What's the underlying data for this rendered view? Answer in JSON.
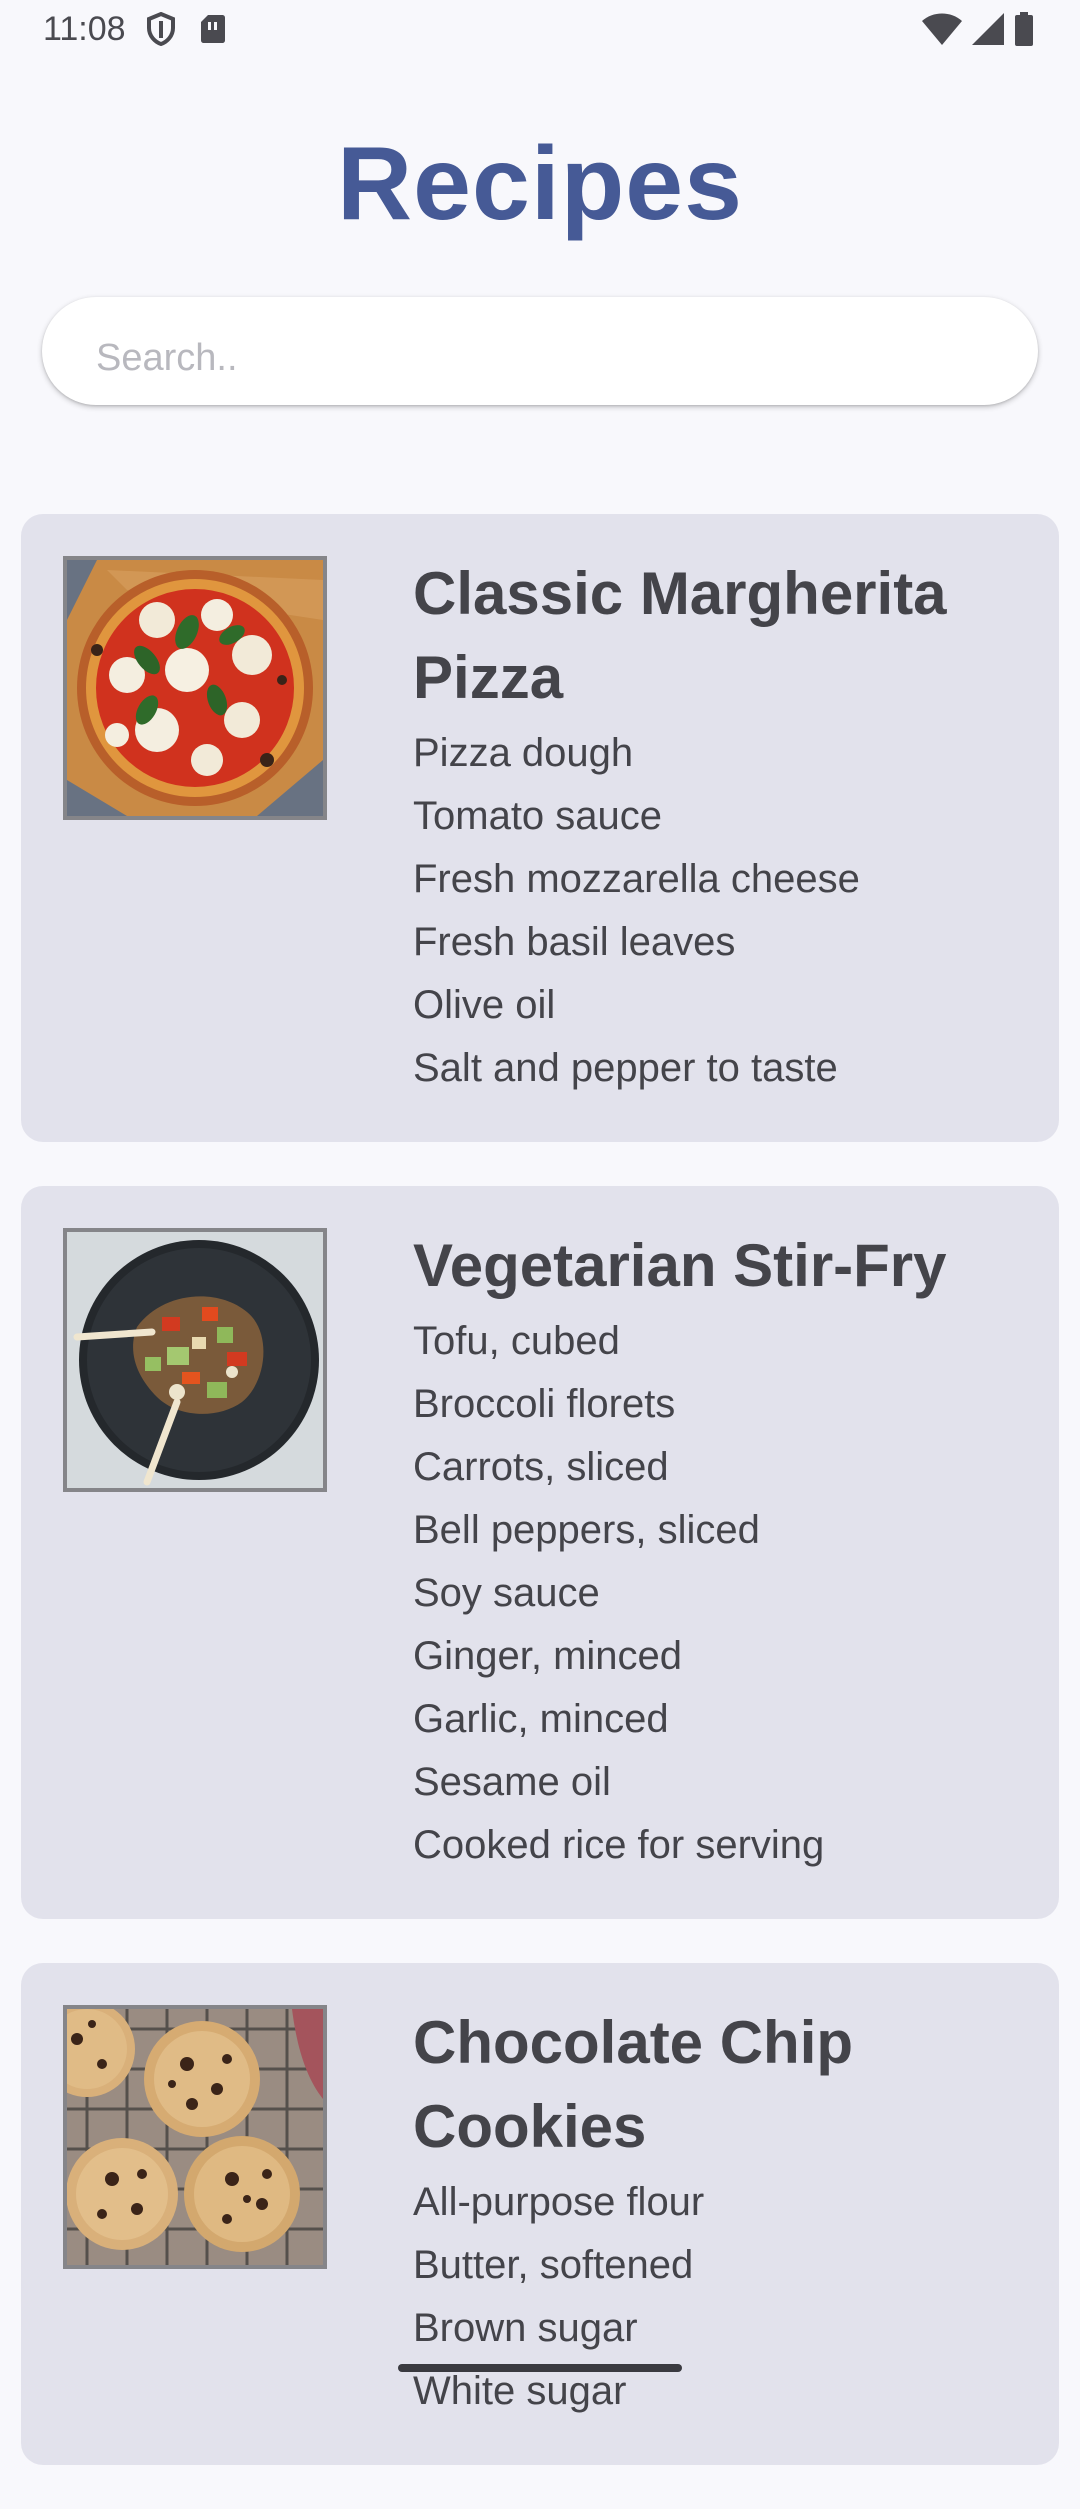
{
  "status_bar": {
    "time": "11:08",
    "icons": [
      "shield-icon",
      "sim-card-icon",
      "wifi-icon",
      "cellular-signal-icon",
      "battery-icon"
    ]
  },
  "header": {
    "title": "Recipes"
  },
  "search": {
    "placeholder": "Search.."
  },
  "colors": {
    "background": "#f8f8fc",
    "title": "#465a96",
    "card": "#e2e2ec",
    "text": "#44444a"
  },
  "recipes": [
    {
      "name": "Classic Margherita Pizza",
      "image": "pizza-photo",
      "ingredients": [
        "Pizza dough",
        "Tomato sauce",
        "Fresh mozzarella cheese",
        "Fresh basil leaves",
        "Olive oil",
        "Salt and pepper to taste"
      ]
    },
    {
      "name": "Vegetarian Stir-Fry",
      "image": "stir-fry-photo",
      "ingredients": [
        "Tofu, cubed",
        "Broccoli florets",
        "Carrots, sliced",
        "Bell peppers, sliced",
        "Soy sauce",
        "Ginger, minced",
        "Garlic, minced",
        "Sesame oil",
        "Cooked rice for serving"
      ]
    },
    {
      "name": "Chocolate Chip Cookies",
      "image": "cookies-photo",
      "ingredients": [
        "All-purpose flour",
        "Butter, softened",
        "Brown sugar",
        "White sugar"
      ]
    }
  ]
}
